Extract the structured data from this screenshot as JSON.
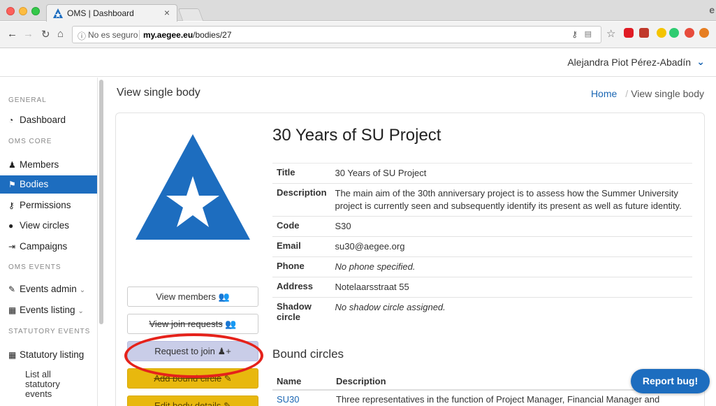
{
  "browser": {
    "tab_title": "OMS | Dashboard",
    "tab_close": "×",
    "url_security": "No es seguro",
    "url_host": "my.aegee.eu",
    "url_path": "/bodies/27"
  },
  "topbar": {
    "user_name": "Alejandra Piot Pérez-Abadín"
  },
  "sidebar": {
    "sections": [
      {
        "heading": "GENERAL"
      },
      {
        "heading": "OMS CORE"
      },
      {
        "heading": "OMS EVENTS"
      },
      {
        "heading": "STATUTORY EVENTS"
      }
    ],
    "items": [
      {
        "label": "Dashboard",
        "icon": "dashboard-icon"
      },
      {
        "label": "Members",
        "icon": "user-icon"
      },
      {
        "label": "Bodies",
        "icon": "flag-icon",
        "active": true
      },
      {
        "label": "Permissions",
        "icon": "key-icon"
      },
      {
        "label": "View circles",
        "icon": "circle-icon"
      },
      {
        "label": "Campaigns",
        "icon": "sign-in-icon"
      },
      {
        "label": "Events admin",
        "icon": "wrench-icon"
      },
      {
        "label": "Events listing",
        "icon": "calendar-icon"
      },
      {
        "label": "Statutory listing",
        "icon": "calendar-icon"
      }
    ],
    "sub_item": "List all statutory events"
  },
  "page": {
    "title": "View single body",
    "breadcrumb_home": "Home",
    "breadcrumb_current": "View single body"
  },
  "body": {
    "name": "30 Years of SU Project",
    "fields": {
      "title_label": "Title",
      "title_value": "30 Years of SU Project",
      "description_label": "Description",
      "description_value": "The main aim of the 30th anniversary project is to assess how the Summer University project is currently seen and subsequently identify its present as well as future identity.",
      "code_label": "Code",
      "code_value": "S30",
      "email_label": "Email",
      "email_value": "su30@aegee.org",
      "phone_label": "Phone",
      "phone_value": "No phone specified.",
      "address_label": "Address",
      "address_value": "Notelaarsstraat 55",
      "shadow_label": "Shadow circle",
      "shadow_value": "No shadow circle assigned."
    }
  },
  "actions": {
    "view_members": "View members",
    "view_join_requests": "View join requests",
    "request_to_join": "Request to join",
    "add_bound_circle": "Add bound circle",
    "edit_body_details": "Edit body details"
  },
  "bound_circles": {
    "heading": "Bound circles",
    "col_name": "Name",
    "col_description": "Description",
    "rows": [
      {
        "name": "SU30",
        "description": "Three representatives in the function of Project Manager, Financial Manager and"
      }
    ]
  },
  "report_bug": "Report bug!",
  "colors": {
    "primary": "#1d6dbf",
    "warning": "#e8b80e",
    "annotation": "#e5221b"
  }
}
